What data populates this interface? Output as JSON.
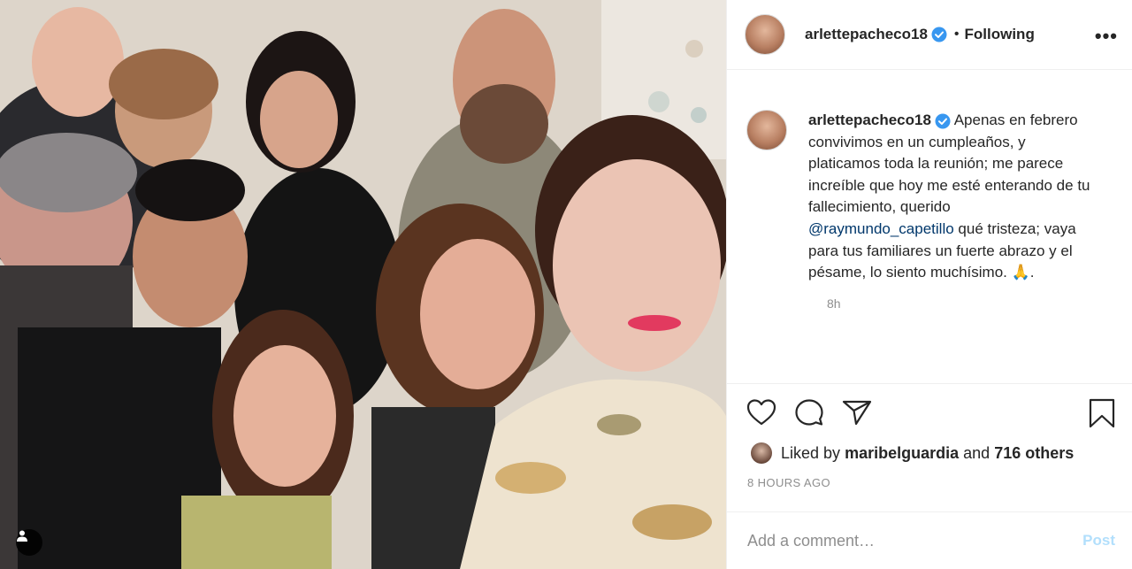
{
  "post": {
    "photo_alt": "",
    "author": {
      "username": "arlettepacheco18",
      "verified": true,
      "follow_status": "Following"
    },
    "caption": {
      "username": "arlettepacheco18",
      "text_before_mention": "Apenas en febrero convivimos en un cumpleaños, y platicamos toda la reunión; me parece increíble que hoy me esté enterando de tu fallecimiento, querido ",
      "mention": "@raymundo_capetillo",
      "text_after_mention": " qué tristeza; vaya para tus familiares un fuerte abrazo y el pésame, lo siento muchísimo. 🙏.",
      "time": "8h"
    },
    "likes": {
      "prefix": "Liked by",
      "user": "maribelguardia",
      "joiner": "and",
      "others": "716 others"
    },
    "timestamp": "8 HOURS AGO"
  },
  "comment_box": {
    "placeholder": "Add a comment…",
    "post_label": "Post"
  },
  "icons": {
    "more": "more-options-icon",
    "like": "heart-icon",
    "comment": "comment-bubble-icon",
    "share": "paper-plane-icon",
    "save": "bookmark-icon",
    "verified": "verified-badge-icon",
    "user_tag": "user-tag-icon"
  },
  "colors": {
    "verified_blue": "#3897f0",
    "mention": "#00376b",
    "muted": "#8e8e8e",
    "post_disabled": "#b2dffc"
  }
}
